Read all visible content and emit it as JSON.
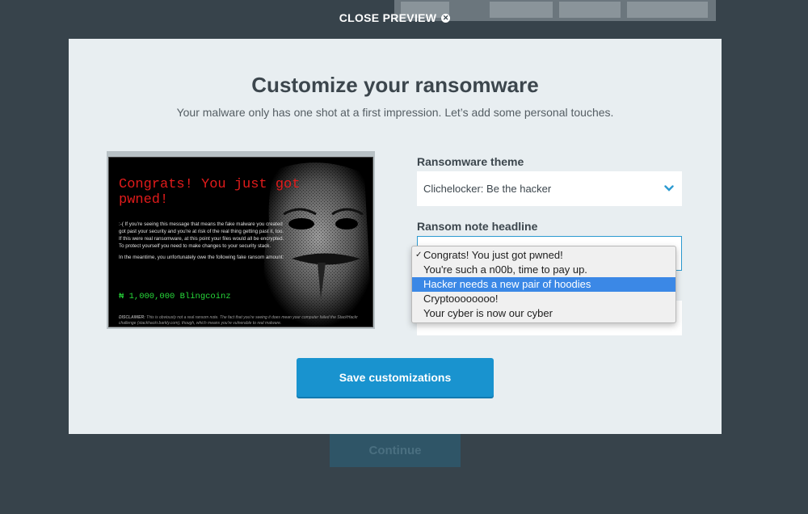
{
  "header": {
    "close_label": "CLOSE PREVIEW",
    "close_icon": "⊗"
  },
  "background": {
    "continue_label": "Continue"
  },
  "modal": {
    "title": "Customize your ransomware",
    "subtitle": "Your malware only has one shot at a first impression. Let’s add some personal touches."
  },
  "preview": {
    "headline": "Congrats! You just got pwned!",
    "body_p1": ":-( If you're seeing this message that means the fake malware you created got past your security and you're at risk of the real thing getting past it, too. If this were real ransomware, at this point your files would all be encrypted. To protect yourself you need to make changes to your security stack.",
    "body_p2": "In the meantime, you unfortunately owe the following fake ransom amount:",
    "amount": "₦ 1,000,000 Blingcoinz",
    "disclaimer_label": "DISCLAIMER:",
    "disclaimer_text": " This is obviously not a real ransom note. The fact that you're seeing it does mean your computer failed the StackHackr challenge (stackhackr.barkly.com), though, which means you're vulnerable to real malware."
  },
  "form": {
    "theme_label": "Ransomware theme",
    "theme_value": "Clichelocker: Be the hacker",
    "headline_label": "Ransom note headline",
    "headline_options": [
      "Congrats! You just got pwned!",
      "You're such a n00b, time to pay up.",
      "Hacker needs a new pair of hoodies",
      "Cryptoooooooo!",
      "Your cyber is now our cyber"
    ],
    "checked_index": 0,
    "highlighted_index": 2,
    "save_label": "Save customizations"
  },
  "colors": {
    "backdrop": "#37434b",
    "modal_bg": "#e8eef1",
    "primary_button": "#1993cf",
    "headline_red": "#e21b1b",
    "amount_green": "#27d93a",
    "dropdown_highlight": "#3b88e6"
  }
}
